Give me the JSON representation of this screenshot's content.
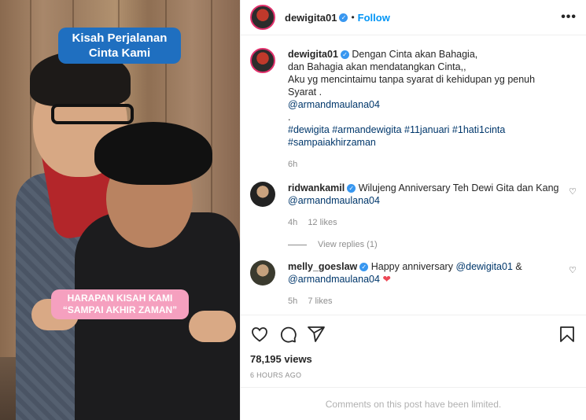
{
  "media": {
    "overlay_title": "Kisah Perjalanan Cinta Kami",
    "overlay_pink_line1": "HARAPAN KISAH KAMI",
    "overlay_pink_line2": "“SAMPAI AKHIR ZAMAN”"
  },
  "header": {
    "username": "dewigita01",
    "follow_label": "Follow",
    "more_label": "•••"
  },
  "caption": {
    "username": "dewigita01",
    "line1": "Dengan Cinta akan Bahagia,",
    "line2": "dan Bahagia akan mendatangkan Cinta,,",
    "line3": "Aku yg mencintaimu tanpa syarat di kehidupan yg penuh Syarat .",
    "mention": "@armandmaulana04",
    "dot": ".",
    "hashtags1": "#dewigita #armandewigita #11januari #1hati1cinta",
    "hashtags2": "#sampaiakhirzaman",
    "time": "6h"
  },
  "comments": [
    {
      "username": "ridwankamil",
      "text": "Wilujeng Anniversary Teh Dewi Gita dan Kang",
      "mention": "@armandmaulana04",
      "time": "4h",
      "likes": "12 likes",
      "view_replies": "View replies (1)"
    },
    {
      "username": "melly_goeslaw",
      "text": "Happy anniversary",
      "mention1": "@dewigita01",
      "amp": "&",
      "mention2": "@armandmaulana04",
      "heart": "❤",
      "time": "5h",
      "likes": "7 likes"
    }
  ],
  "stats": {
    "views": "78,195 views",
    "posted": "6 HOURS AGO"
  },
  "footer": {
    "limited": "Comments on this post have been limited."
  },
  "colors": {
    "accent": "#0095f6",
    "verified": "#3897f0",
    "overlay_blue": "#1f6fc0",
    "overlay_pink": "#f5a0bf"
  }
}
